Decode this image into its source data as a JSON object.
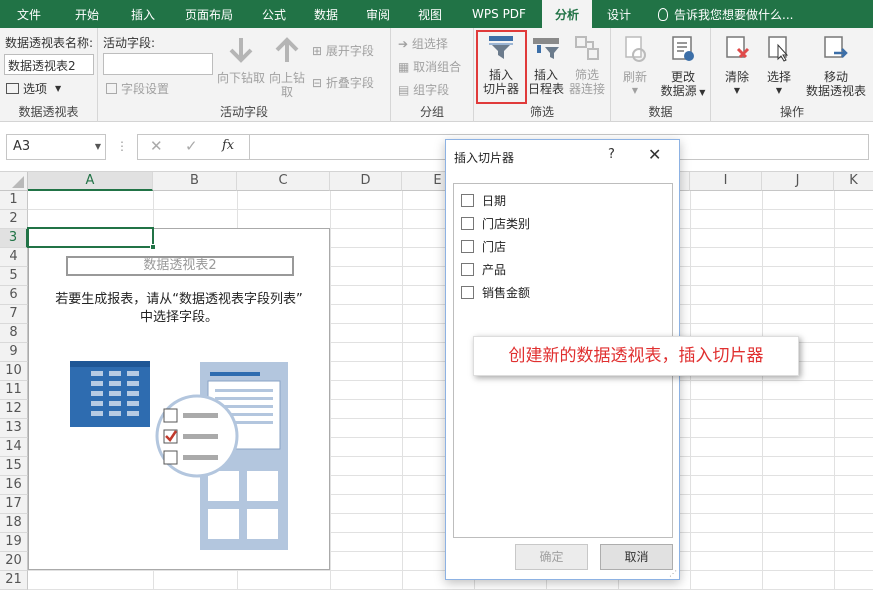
{
  "tabs": [
    "文件",
    "开始",
    "插入",
    "页面布局",
    "公式",
    "数据",
    "审阅",
    "视图",
    "WPS PDF",
    "分析",
    "设计"
  ],
  "active_tab": "分析",
  "tell_me": "告诉我您想要做什么...",
  "ribbon": {
    "pivot_group": {
      "name_label": "数据透视表名称:",
      "name_value": "数据透视表2",
      "options": "选项",
      "label": "数据透视表"
    },
    "active_field_group": {
      "field_label": "活动字段:",
      "field_settings": "字段设置",
      "drill_down": "向下钻取",
      "drill_up_1": "向上钻",
      "drill_up_2": "取",
      "expand": "展开字段",
      "collapse": "折叠字段",
      "label": "活动字段"
    },
    "group_group": {
      "group_selection": "组选择",
      "ungroup": "取消组合",
      "group_field": "组字段",
      "label": "分组"
    },
    "filter_group": {
      "slicer_1": "插入",
      "slicer_2": "切片器",
      "timeline_1": "插入",
      "timeline_2": "日程表",
      "connections_1": "筛选",
      "connections_2": "器连接",
      "label": "筛选"
    },
    "data_group": {
      "refresh": "刷新",
      "change_source_1": "更改",
      "change_source_2": "数据源",
      "label": "数据"
    },
    "actions_group": {
      "clear": "清除",
      "select": "选择",
      "move_1": "移动",
      "move_2": "数据透视表",
      "label": "操作"
    }
  },
  "formula_bar": {
    "name_box": "A3",
    "fx": "fx"
  },
  "columns": [
    "A",
    "B",
    "C",
    "D",
    "E",
    "F",
    "G",
    "H",
    "I",
    "J",
    "K"
  ],
  "rows": [
    "1",
    "2",
    "3",
    "4",
    "5",
    "6",
    "7",
    "8",
    "9",
    "10",
    "11",
    "12",
    "13",
    "14",
    "15",
    "16",
    "17",
    "18",
    "19",
    "20",
    "21"
  ],
  "pivot_placeholder": {
    "title": "数据透视表2",
    "line1": "若要生成报表，请从“数据透视表字段列表”",
    "line2": "中选择字段。"
  },
  "dialog": {
    "title": "插入切片器",
    "help": "?",
    "fields": [
      "日期",
      "门店类别",
      "门店",
      "产品",
      "销售金额"
    ],
    "ok": "确定",
    "cancel": "取消"
  },
  "annotation": "创建新的数据透视表，插入切片器",
  "colors": {
    "accent": "#217346",
    "highlight": "#e03a3a"
  }
}
